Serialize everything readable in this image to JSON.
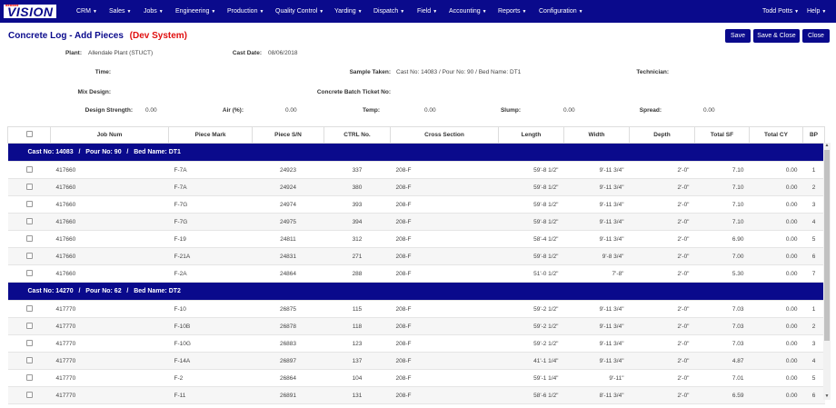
{
  "nav": {
    "logo_text": "VISION",
    "logo_small": "■■■■■■",
    "items": [
      "CRM",
      "Sales",
      "Jobs",
      "Engineering",
      "Production",
      "Quality Control",
      "Yarding",
      "Dispatch",
      "Field",
      "Accounting",
      "Reports",
      "Configuration"
    ],
    "user": "Todd Potts",
    "help": "Help"
  },
  "page": {
    "title": "Concrete Log - Add Pieces",
    "dev_label": "(Dev System)"
  },
  "buttons": {
    "save": "Save",
    "save_close": "Save & Close",
    "close": "Close"
  },
  "form": {
    "plant_label": "Plant:",
    "plant_value": "Allendale Plant (STUCT)",
    "cast_date_label": "Cast Date:",
    "cast_date_value": "08/06/2018",
    "time_label": "Time:",
    "sample_taken_label": "Sample Taken:",
    "sample_taken_value": "Cast No: 14083 / Pour No: 90 / Bed Name: DT1",
    "technician_label": "Technician:",
    "mix_design_label": "Mix Design:",
    "batch_ticket_label": "Concrete Batch Ticket No:",
    "strength_label": "Design Strength:",
    "strength_value": "0.00",
    "air_label": "Air (%):",
    "air_value": "0.00",
    "temp_label": "Temp:",
    "temp_value": "0.00",
    "slump_label": "Slump:",
    "slump_value": "0.00",
    "spread_label": "Spread:",
    "spread_value": "0.00"
  },
  "table": {
    "headers": [
      "",
      "Job Num",
      "Piece Mark",
      "Piece S/N",
      "CTRL No.",
      "Cross Section",
      "Length",
      "Width",
      "Depth",
      "Total SF",
      "Total CY",
      "BP"
    ],
    "groups": [
      {
        "label": "Cast No: 14083   /   Pour No: 90   /   Bed Name: DT1",
        "rows": [
          [
            "417660",
            "F-7A",
            "24923",
            "337",
            "208-F",
            "59'-8 1/2\"",
            "9'-11 3/4\"",
            "2'-0\"",
            "7.10",
            "0.00",
            "1"
          ],
          [
            "417660",
            "F-7A",
            "24924",
            "380",
            "208-F",
            "59'-8 1/2\"",
            "9'-11 3/4\"",
            "2'-0\"",
            "7.10",
            "0.00",
            "2"
          ],
          [
            "417660",
            "F-7G",
            "24974",
            "393",
            "208-F",
            "59'-8 1/2\"",
            "9'-11 3/4\"",
            "2'-0\"",
            "7.10",
            "0.00",
            "3"
          ],
          [
            "417660",
            "F-7G",
            "24975",
            "394",
            "208-F",
            "59'-8 1/2\"",
            "9'-11 3/4\"",
            "2'-0\"",
            "7.10",
            "0.00",
            "4"
          ],
          [
            "417660",
            "F-19",
            "24811",
            "312",
            "208-F",
            "58'-4 1/2\"",
            "9'-11 3/4\"",
            "2'-0\"",
            "6.90",
            "0.00",
            "5"
          ],
          [
            "417660",
            "F-21A",
            "24831",
            "271",
            "208-F",
            "59'-8 1/2\"",
            "9'-8 3/4\"",
            "2'-0\"",
            "7.00",
            "0.00",
            "6"
          ],
          [
            "417660",
            "F-2A",
            "24864",
            "288",
            "208-F",
            "51'-0 1/2\"",
            "7'-8\"",
            "2'-0\"",
            "5.30",
            "0.00",
            "7"
          ]
        ]
      },
      {
        "label": "Cast No: 14270   /   Pour No: 62   /   Bed Name: DT2",
        "rows": [
          [
            "417770",
            "F-10",
            "26875",
            "115",
            "208-F",
            "59'-2 1/2\"",
            "9'-11 3/4\"",
            "2'-0\"",
            "7.03",
            "0.00",
            "1"
          ],
          [
            "417770",
            "F-10B",
            "26878",
            "118",
            "208-F",
            "59'-2 1/2\"",
            "9'-11 3/4\"",
            "2'-0\"",
            "7.03",
            "0.00",
            "2"
          ],
          [
            "417770",
            "F-10G",
            "26883",
            "123",
            "208-F",
            "59'-2 1/2\"",
            "9'-11 3/4\"",
            "2'-0\"",
            "7.03",
            "0.00",
            "3"
          ],
          [
            "417770",
            "F-14A",
            "26897",
            "137",
            "208-F",
            "41'-1 1/4\"",
            "9'-11 3/4\"",
            "2'-0\"",
            "4.87",
            "0.00",
            "4"
          ],
          [
            "417770",
            "F-2",
            "26864",
            "104",
            "208-F",
            "59'-1 1/4\"",
            "9'-11\"",
            "2'-0\"",
            "7.01",
            "0.00",
            "5"
          ],
          [
            "417770",
            "F-11",
            "26891",
            "131",
            "208-F",
            "58'-6 1/2\"",
            "8'-11 3/4\"",
            "2'-0\"",
            "6.59",
            "0.00",
            "6"
          ]
        ]
      }
    ]
  }
}
